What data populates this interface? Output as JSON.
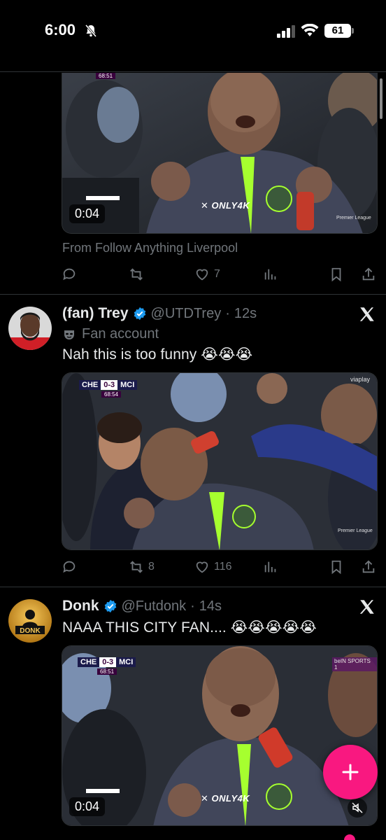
{
  "status_bar": {
    "time": "6:00",
    "battery": "61"
  },
  "tweet1": {
    "media": {
      "duration": "0:04",
      "watermark": "ONLY4K",
      "clock": "68:51",
      "broadcaster": "Premier League"
    },
    "context": "From Follow Anything Liverpool",
    "actions": {
      "replies": "",
      "reposts": "",
      "likes": "7"
    }
  },
  "tweet2": {
    "name": "(fan) Trey",
    "handle": "@UTDTrey",
    "time": "12s",
    "label": "Fan account",
    "text": "Nah this is too funny 😭😭😭",
    "media": {
      "team_home": "CHE",
      "score": "0-3",
      "team_away": "MCI",
      "clock": "68:54",
      "broadcaster": "viaplay",
      "pl": "Premier League"
    },
    "actions": {
      "replies": "",
      "reposts": "8",
      "likes": "116"
    }
  },
  "tweet3": {
    "name": "Donk",
    "handle": "@Futdonk",
    "time": "14s",
    "avatar_text": "DONK",
    "text": "NAAA THIS CITY FAN.... 😭😭😭😭😭",
    "media": {
      "team_home": "CHE",
      "score": "0-3",
      "team_away": "MCI",
      "clock": "68:51",
      "duration": "0:04",
      "watermark": "ONLY4K",
      "broadcaster": "beIN SPORTS 1"
    }
  },
  "colors": {
    "accent": "#f91880",
    "verified": "#1d9bf0",
    "muted": "#71767b",
    "divider": "#2f3336"
  },
  "icons": [
    "bell-slash-icon",
    "signal-icon",
    "wifi-icon",
    "reply-icon",
    "repost-icon",
    "like-icon",
    "views-icon",
    "bookmark-icon",
    "share-icon",
    "x-logo-icon",
    "verified-icon",
    "fan-mask-icon",
    "compose-plus-icon",
    "mute-icon"
  ]
}
